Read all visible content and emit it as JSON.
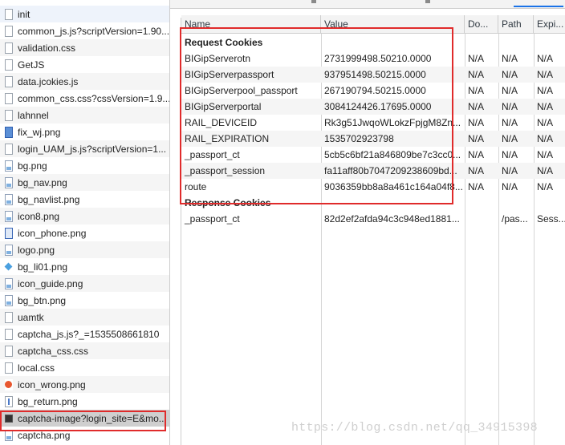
{
  "requests": [
    {
      "name": "init",
      "icon": "document-icon"
    },
    {
      "name": "common_js.js?scriptVersion=1.90...",
      "icon": "document-icon"
    },
    {
      "name": "validation.css",
      "icon": "document-icon"
    },
    {
      "name": "GetJS",
      "icon": "document-icon"
    },
    {
      "name": "data.jcokies.js",
      "icon": "document-icon"
    },
    {
      "name": "common_css.css?cssVersion=1.9...",
      "icon": "document-icon"
    },
    {
      "name": "lahnnel",
      "icon": "document-icon"
    },
    {
      "name": "fix_wj.png",
      "icon": "image-icon"
    },
    {
      "name": "login_UAM_js.js?scriptVersion=1...",
      "icon": "document-icon"
    },
    {
      "name": "bg.png",
      "icon": "image-icon"
    },
    {
      "name": "bg_nav.png",
      "icon": "image-icon"
    },
    {
      "name": "bg_navlist.png",
      "icon": "image-icon"
    },
    {
      "name": "icon8.png",
      "icon": "image-icon"
    },
    {
      "name": "icon_phone.png",
      "icon": "phone-image-icon"
    },
    {
      "name": "logo.png",
      "icon": "image-icon"
    },
    {
      "name": "bg_li01.png",
      "icon": "diamond-image-icon"
    },
    {
      "name": "icon_guide.png",
      "icon": "image-icon"
    },
    {
      "name": "bg_btn.png",
      "icon": "image-icon"
    },
    {
      "name": "uamtk",
      "icon": "document-icon"
    },
    {
      "name": "captcha_js.js?_=1535508661810",
      "icon": "document-icon"
    },
    {
      "name": "captcha_css.css",
      "icon": "document-icon"
    },
    {
      "name": "local.css",
      "icon": "document-icon"
    },
    {
      "name": "icon_wrong.png",
      "icon": "error-image-icon"
    },
    {
      "name": "bg_return.png",
      "icon": "image-icon"
    },
    {
      "name": "captcha-image?login_site=E&mo...",
      "icon": "captcha-image-icon",
      "selected": true
    },
    {
      "name": "captcha.png",
      "icon": "image-icon"
    }
  ],
  "cookies": {
    "columns": {
      "name": "Name",
      "value": "Value",
      "domain": "Do...",
      "path": "Path",
      "expires": "Expi..."
    },
    "request_label": "Request Cookies",
    "request_cookies": [
      {
        "name": "BIGipServerotn",
        "value": "2731999498.50210.0000",
        "domain": "N/A",
        "path": "N/A",
        "expires": "N/A"
      },
      {
        "name": "BIGipServerpassport",
        "value": "937951498.50215.0000",
        "domain": "N/A",
        "path": "N/A",
        "expires": "N/A"
      },
      {
        "name": "BIGipServerpool_passport",
        "value": "267190794.50215.0000",
        "domain": "N/A",
        "path": "N/A",
        "expires": "N/A"
      },
      {
        "name": "BIGipServerportal",
        "value": "3084124426.17695.0000",
        "domain": "N/A",
        "path": "N/A",
        "expires": "N/A"
      },
      {
        "name": "RAIL_DEVICEID",
        "value": "Rk3g51JwqoWLokzFpjgM8Zn...",
        "domain": "N/A",
        "path": "N/A",
        "expires": "N/A"
      },
      {
        "name": "RAIL_EXPIRATION",
        "value": "1535702923798",
        "domain": "N/A",
        "path": "N/A",
        "expires": "N/A"
      },
      {
        "name": "_passport_ct",
        "value": "5cb5c6bf21a846809be7c3cc0...",
        "domain": "N/A",
        "path": "N/A",
        "expires": "N/A"
      },
      {
        "name": "_passport_session",
        "value": "fa11aff80b7047209238609bd...",
        "domain": "N/A",
        "path": "N/A",
        "expires": "N/A"
      },
      {
        "name": "route",
        "value": "9036359bb8a8a461c164a04f8...",
        "domain": "N/A",
        "path": "N/A",
        "expires": "N/A"
      }
    ],
    "response_label": "Response Cookies",
    "response_cookies": [
      {
        "name": "_passport_ct",
        "value": "82d2ef2afda94c3c948ed1881...",
        "domain": "",
        "path": "/pas...",
        "expires": "Sess..."
      }
    ]
  },
  "watermark": "https://blog.csdn.net/qq_34915398",
  "colors": {
    "highlight": "#e02b2b",
    "active_tab": "#1a73e8"
  }
}
